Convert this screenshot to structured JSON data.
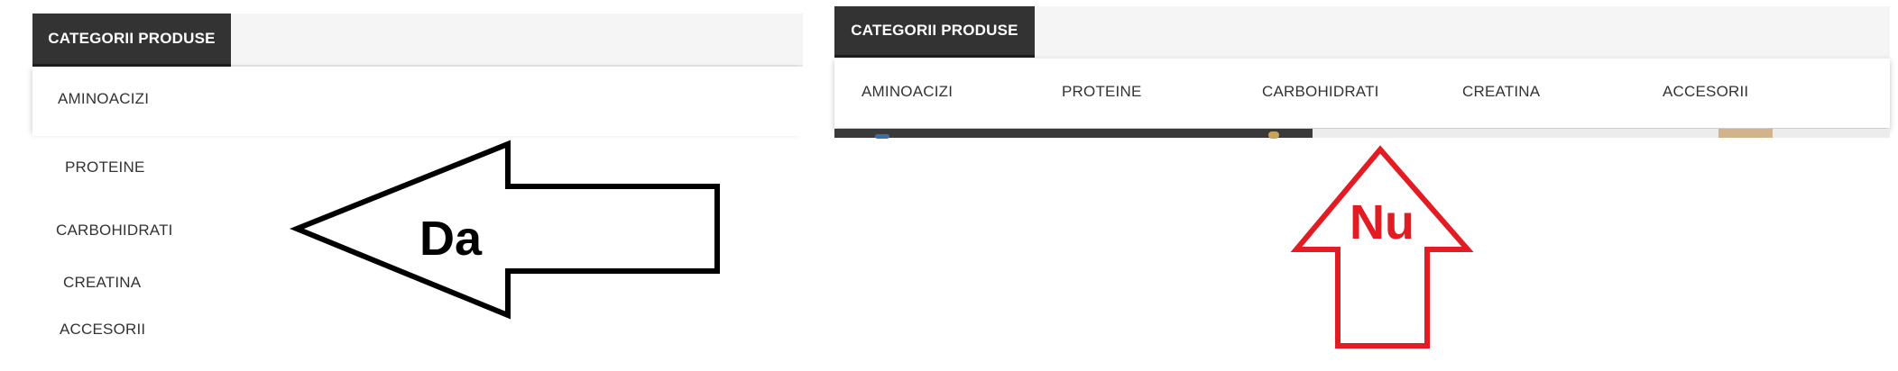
{
  "left_panel": {
    "header_label": "CATEGORII PRODUSE",
    "items": [
      "AMINOACIZI",
      "PROTEINE",
      "CARBOHIDRATI",
      "CREATINA",
      "ACCESORII"
    ]
  },
  "right_panel": {
    "header_label": "CATEGORII PRODUSE",
    "items": [
      "AMINOACIZI",
      "PROTEINE",
      "CARBOHIDRATI",
      "CREATINA",
      "ACCESORII"
    ]
  },
  "annotations": {
    "left_arrow_label": "Da",
    "right_arrow_label": "Nu",
    "left_arrow_color": "#000000",
    "right_arrow_color": "#e31b23"
  },
  "colors": {
    "header_tab": "#333333",
    "header_bar": "#f5f5f5",
    "menu_text": "#333333"
  }
}
